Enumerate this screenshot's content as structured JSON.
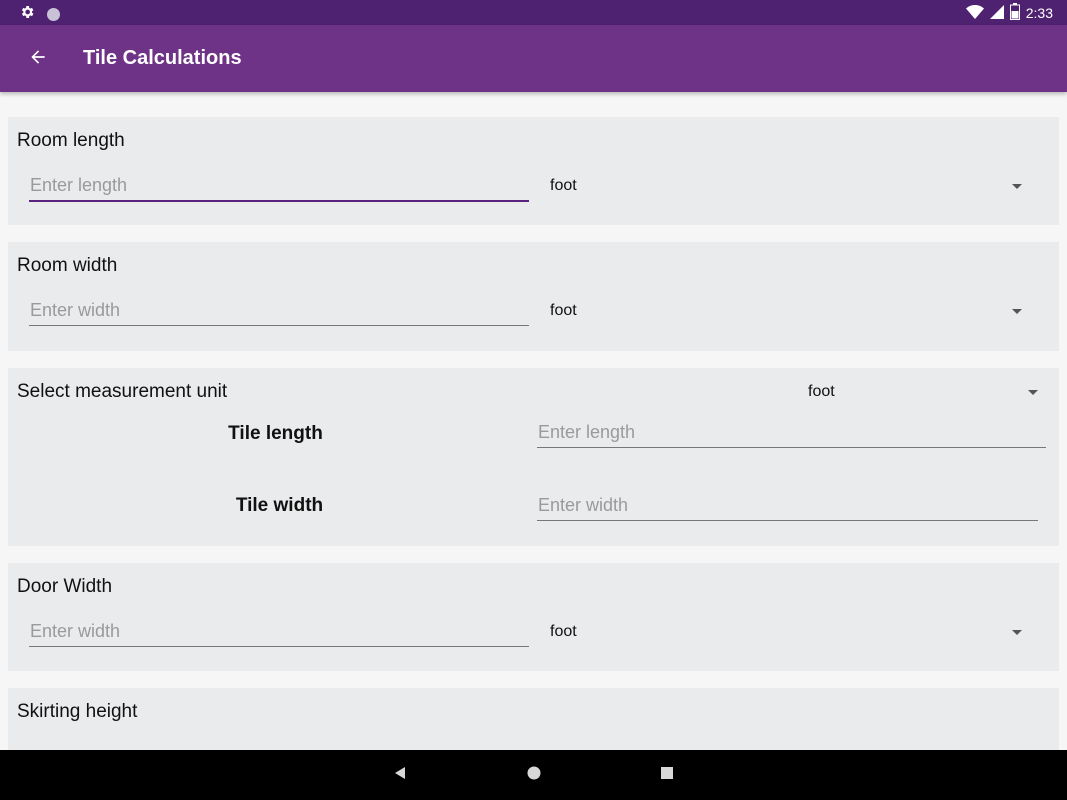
{
  "status_bar": {
    "time": "2:33",
    "icons": [
      "settings-icon",
      "circle-icon",
      "wifi-icon",
      "signal-icon",
      "battery-icon"
    ]
  },
  "app_bar": {
    "title": "Tile Calculations",
    "back_icon": "arrow-back-icon"
  },
  "room_length": {
    "title": "Room length",
    "placeholder": "Enter length",
    "unit": "foot"
  },
  "room_width": {
    "title": "Room width",
    "placeholder": "Enter width",
    "unit": "foot"
  },
  "tile": {
    "title": "Select measurement unit",
    "unit": "foot",
    "length_label": "Tile length",
    "length_placeholder": "Enter length",
    "width_label": "Tile width",
    "width_placeholder": "Enter width"
  },
  "door_width": {
    "title": "Door Width",
    "placeholder": "Enter width",
    "unit": "foot"
  },
  "skirting": {
    "title": "Skirting height"
  },
  "nav_bar": {
    "icons": [
      "back-triangle-icon",
      "home-circle-icon",
      "recents-square-icon"
    ]
  },
  "colors": {
    "status_bar": "#4e2270",
    "app_bar": "#6e3286",
    "accent": "#5b2380",
    "card": "#e9ebec"
  }
}
